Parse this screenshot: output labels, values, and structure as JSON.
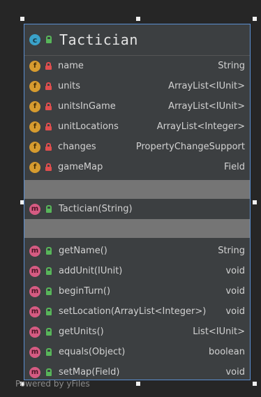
{
  "class": {
    "name": "Tactician",
    "kind_badge": "c"
  },
  "fields": [
    {
      "badge": "f",
      "name": "name",
      "type": "String"
    },
    {
      "badge": "f",
      "name": "units",
      "type": "ArrayList<IUnit>"
    },
    {
      "badge": "f",
      "name": "unitsInGame",
      "type": "ArrayList<IUnit>"
    },
    {
      "badge": "f",
      "name": "unitLocations",
      "type": "ArrayList<Integer>"
    },
    {
      "badge": "f",
      "name": "changes",
      "type": "PropertyChangeSupport"
    },
    {
      "badge": "f",
      "name": "gameMap",
      "type": "Field"
    }
  ],
  "constructors": [
    {
      "badge": "m",
      "name": "Tactician(String)"
    }
  ],
  "methods": [
    {
      "badge": "m",
      "name": "getName()",
      "type": "String"
    },
    {
      "badge": "m",
      "name": "addUnit(IUnit)",
      "type": "void"
    },
    {
      "badge": "m",
      "name": "beginTurn()",
      "type": "void"
    },
    {
      "badge": "m",
      "name": "setLocation(ArrayList<Integer>)",
      "type": "void"
    },
    {
      "badge": "m",
      "name": "getUnits()",
      "type": "List<IUnit>"
    },
    {
      "badge": "m",
      "name": "equals(Object)",
      "type": "boolean"
    },
    {
      "badge": "m",
      "name": "setMap(Field)",
      "type": "void"
    }
  ],
  "watermark": "Powered by yFiles",
  "colors": {
    "background": "#262626",
    "box": "#3c3f41",
    "selection_border": "#5b8fd1",
    "field_badge": "#d69b2f",
    "method_badge": "#d55b82",
    "class_badge": "#3aa2c9",
    "public_icon": "#58b65a",
    "private_icon": "#e04e4e"
  }
}
